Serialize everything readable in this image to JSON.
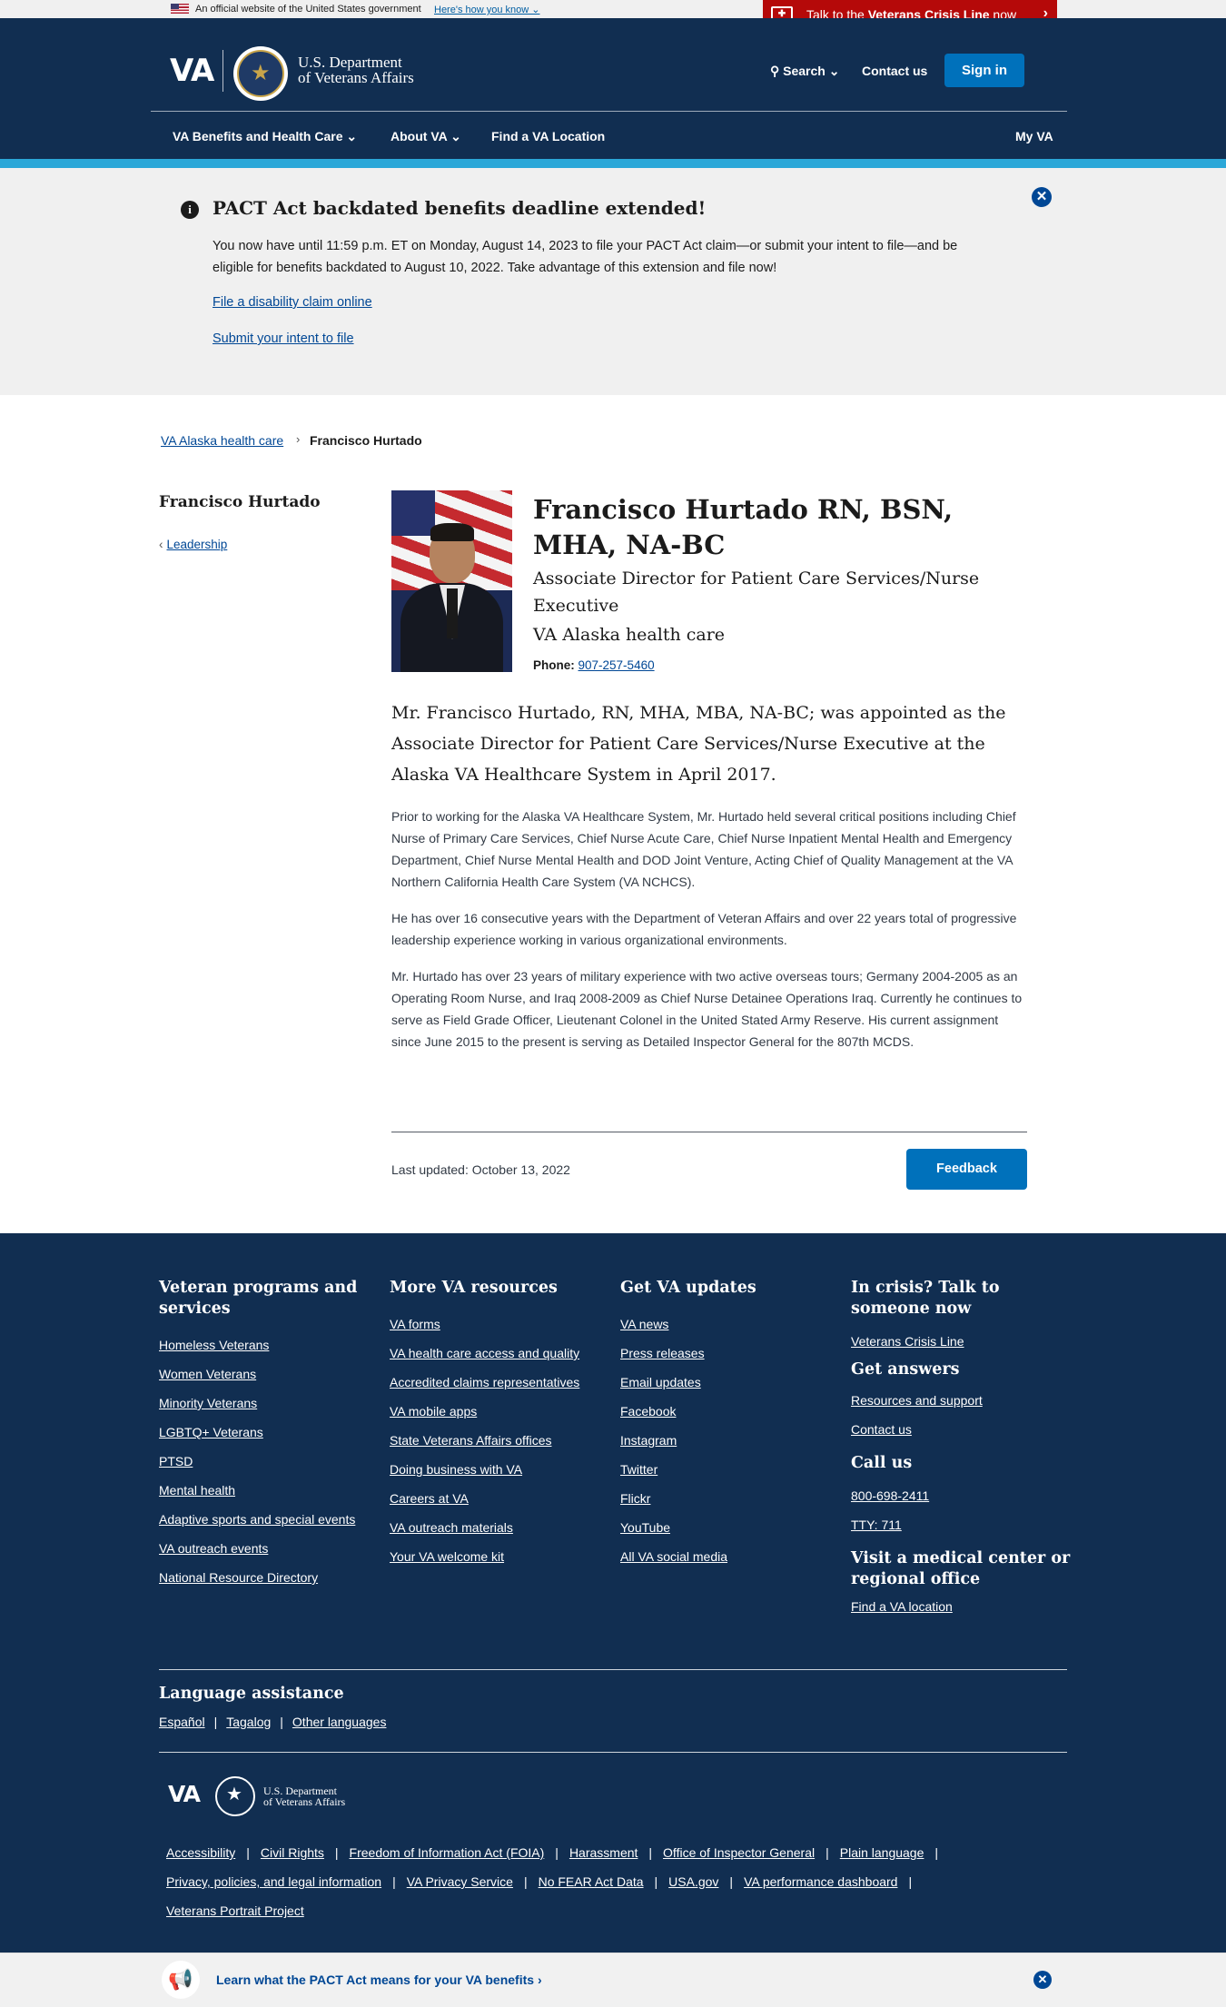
{
  "official_banner": {
    "text": "An official website of the United States government",
    "how_link": "Here's how you know ⌄"
  },
  "crisis_line": {
    "prefix": "Talk to the ",
    "bold": "Veterans Crisis Line",
    "suffix": " now",
    "chevron": "›"
  },
  "header": {
    "logo": "VA",
    "dept_line1": "U.S. Department",
    "dept_line2": "of Veterans Affairs",
    "search": "⚲ Search ⌄",
    "contact": "Contact us",
    "sign_in": "Sign in",
    "nav": [
      "VA Benefits and Health Care ⌄",
      "About VA ⌄",
      "Find a VA Location"
    ],
    "my_va": "My VA"
  },
  "alert": {
    "icon": "i",
    "title": "PACT Act backdated benefits deadline extended!",
    "body": "You now have until 11:59 p.m. ET on Monday, August 14, 2023 to file your PACT Act claim—or submit your intent to file—and be eligible for benefits backdated to August 10, 2022. Take advantage of this extension and file now!",
    "link1": "File a disability claim online",
    "link2": "Submit your intent to file",
    "close": "✕"
  },
  "breadcrumb": {
    "parent": "VA Alaska health care",
    "separator": "›",
    "current": "Francisco Hurtado"
  },
  "sidebar": {
    "title": "Francisco Hurtado",
    "back_chevron": "‹",
    "back_link": "Leadership"
  },
  "profile": {
    "name": "Francisco Hurtado RN, BSN, MHA, NA-BC",
    "role": "Associate Director for Patient Care Services/Nurse Executive",
    "org": "VA Alaska health care",
    "phone_label": "Phone:",
    "phone": "907-257-5460"
  },
  "content": {
    "lead": "Mr. Francisco Hurtado, RN, MHA, MBA, NA-BC; was appointed as the Associate Director for Patient Care Services/Nurse Executive at the Alaska VA Healthcare System in April 2017.",
    "p1": "Prior to working for the Alaska VA Healthcare System, Mr. Hurtado held several critical positions including Chief Nurse of Primary Care Services, Chief Nurse Acute Care, Chief Nurse Inpatient Mental Health and Emergency Department, Chief Nurse Mental Health and DOD Joint Venture, Acting Chief of Quality Management at the VA Northern California Health Care System (VA NCHCS).",
    "p2": "He has over 16 consecutive years with the Department of Veteran Affairs and over 22 years total of progressive leadership experience working in various organizational environments.",
    "p3": "Mr. Hurtado has over 23 years of military experience with two active overseas tours; Germany 2004-2005 as an Operating Room Nurse, and Iraq 2008-2009 as Chief Nurse Detainee Operations Iraq. Currently he continues to serve as Field Grade Officer, Lieutenant Colonel in the United Stated Army Reserve. His current assignment since June 2015 to the present is serving as Detailed Inspector General for the 807th MCDS.",
    "last_updated": "Last updated: October 13, 2022",
    "feedback": "Feedback"
  },
  "footer": {
    "col1": {
      "heading": "Veteran programs and services",
      "links": [
        "Homeless Veterans",
        "Women Veterans",
        "Minority Veterans",
        "LGBTQ+ Veterans",
        "PTSD",
        "Mental health",
        "Adaptive sports and special events",
        "VA outreach events",
        "National Resource Directory"
      ]
    },
    "col2": {
      "heading": "More VA resources",
      "links": [
        "VA forms",
        "VA health care access and quality",
        "Accredited claims representatives",
        "VA mobile apps",
        "State Veterans Affairs offices",
        "Doing business with VA",
        "Careers at VA",
        "VA outreach materials",
        "Your VA welcome kit"
      ]
    },
    "col3": {
      "heading": "Get VA updates",
      "links": [
        "VA news",
        "Press releases",
        "Email updates",
        "Facebook",
        "Instagram",
        "Twitter",
        "Flickr",
        "YouTube",
        "All VA social media"
      ]
    },
    "col4": {
      "heading_crisis": "In crisis? Talk to someone now",
      "crisis_link": "Veterans Crisis Line",
      "heading_answers": "Get answers",
      "answers_links": [
        "Resources and support",
        "Contact us"
      ],
      "heading_call": "Call us",
      "call_links": [
        "800-698-2411",
        "TTY: 711"
      ],
      "heading_visit": "Visit a medical center or regional office",
      "visit_link": "Find a VA location"
    },
    "language": {
      "heading": "Language assistance",
      "links": [
        "Español",
        "Tagalog",
        "Other languages"
      ],
      "sep": "|"
    },
    "logo": "VA",
    "dept_line1": "U.S. Department",
    "dept_line2": "of Veterans Affairs",
    "bottom_links": [
      "Accessibility",
      "Civil Rights",
      "Freedom of Information Act (FOIA)",
      "Harassment",
      "Office of Inspector General",
      "Plain language",
      "Privacy, policies, and legal information",
      "VA Privacy Service",
      "No FEAR Act Data",
      "USA.gov",
      "VA performance dashboard",
      "Veterans Portrait Project"
    ]
  },
  "promo": {
    "icon": "📢",
    "text": "Learn what the PACT Act means for your VA benefits ›",
    "close": "✕"
  }
}
